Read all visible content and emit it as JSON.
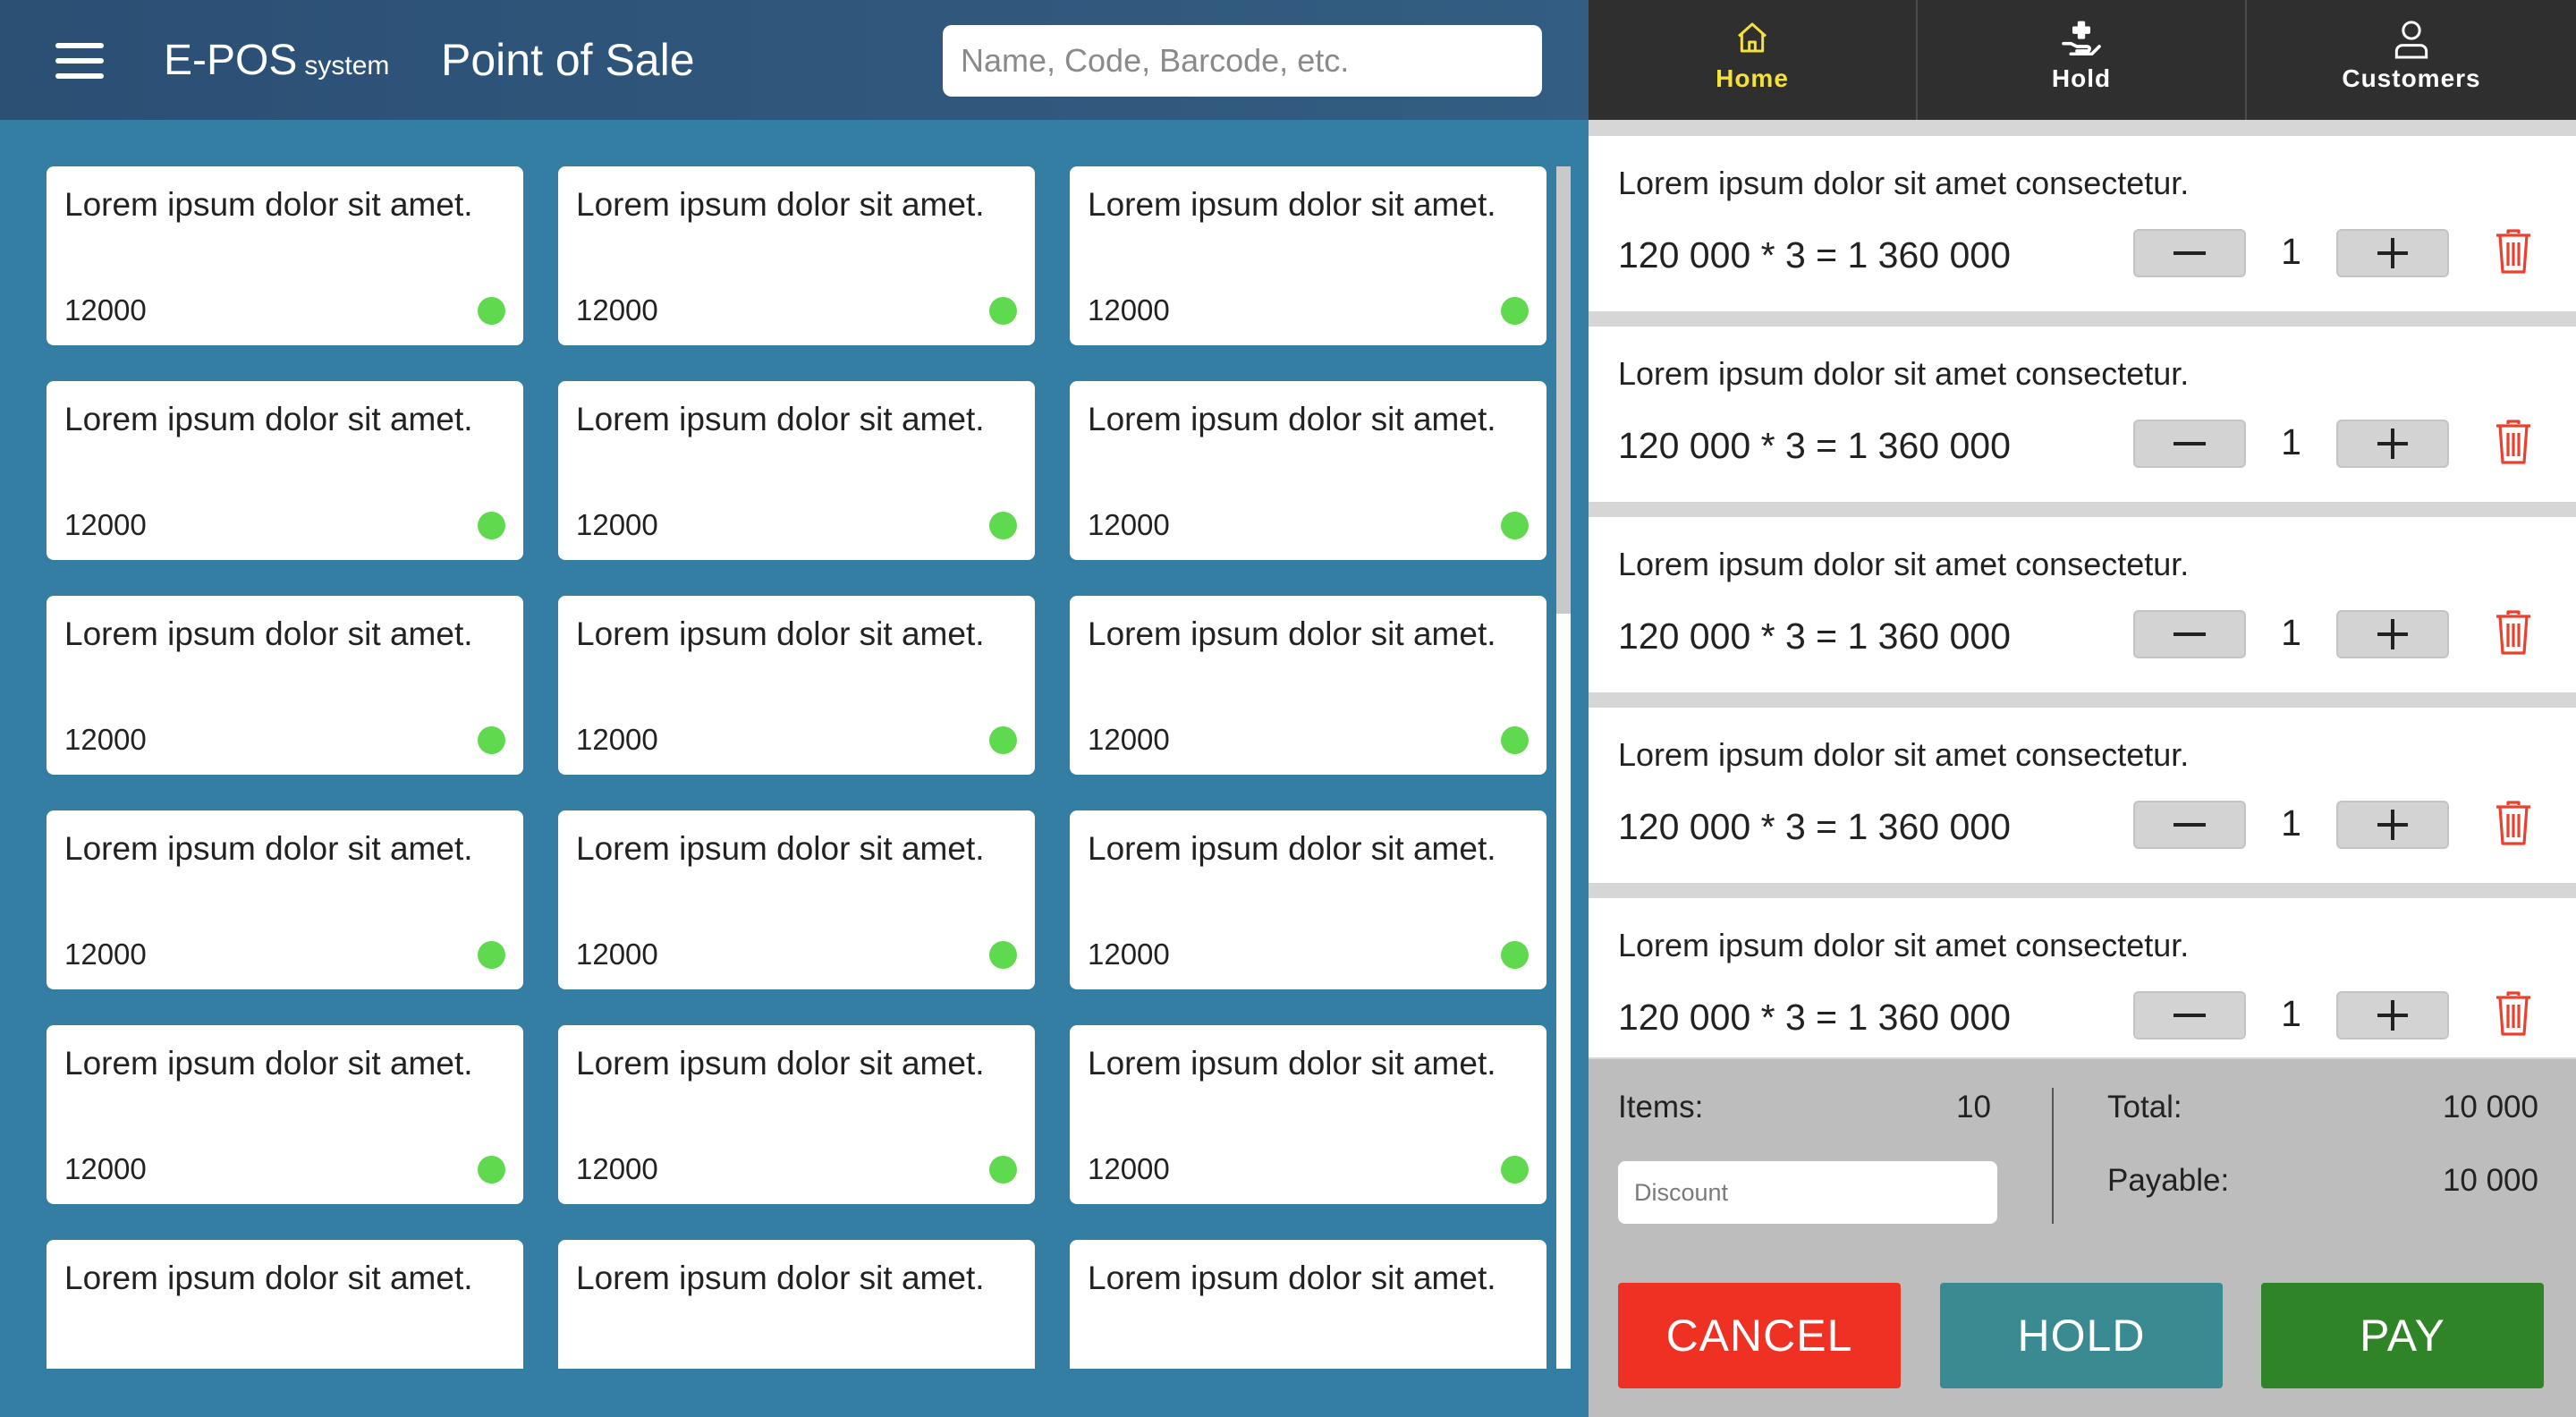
{
  "header": {
    "brand_main": "E-POS",
    "brand_sub": "system",
    "page_title": "Point of Sale",
    "search_placeholder": "Name, Code, Barcode, etc."
  },
  "products": [
    {
      "name": "Lorem ipsum dolor sit amet.",
      "price": "12000",
      "in_stock": true
    },
    {
      "name": "Lorem ipsum dolor sit amet.",
      "price": "12000",
      "in_stock": true
    },
    {
      "name": "Lorem ipsum dolor sit amet.",
      "price": "12000",
      "in_stock": true
    },
    {
      "name": "Lorem ipsum dolor sit amet.",
      "price": "12000",
      "in_stock": true
    },
    {
      "name": "Lorem ipsum dolor sit amet.",
      "price": "12000",
      "in_stock": true
    },
    {
      "name": "Lorem ipsum dolor sit amet.",
      "price": "12000",
      "in_stock": true
    },
    {
      "name": "Lorem ipsum dolor sit amet.",
      "price": "12000",
      "in_stock": true
    },
    {
      "name": "Lorem ipsum dolor sit amet.",
      "price": "12000",
      "in_stock": true
    },
    {
      "name": "Lorem ipsum dolor sit amet.",
      "price": "12000",
      "in_stock": true
    },
    {
      "name": "Lorem ipsum dolor sit amet.",
      "price": "12000",
      "in_stock": true
    },
    {
      "name": "Lorem ipsum dolor sit amet.",
      "price": "12000",
      "in_stock": true
    },
    {
      "name": "Lorem ipsum dolor sit amet.",
      "price": "12000",
      "in_stock": true
    },
    {
      "name": "Lorem ipsum dolor sit amet.",
      "price": "12000",
      "in_stock": true
    },
    {
      "name": "Lorem ipsum dolor sit amet.",
      "price": "12000",
      "in_stock": true
    },
    {
      "name": "Lorem ipsum dolor sit amet.",
      "price": "12000",
      "in_stock": true
    },
    {
      "name": "Lorem ipsum dolor sit amet.",
      "price": "",
      "in_stock": false
    },
    {
      "name": "Lorem ipsum dolor sit amet.",
      "price": "",
      "in_stock": false
    },
    {
      "name": "Lorem ipsum dolor sit amet.",
      "price": "",
      "in_stock": false
    }
  ],
  "nav": {
    "tabs": [
      {
        "label": "Home",
        "icon": "home-icon",
        "active": true
      },
      {
        "label": "Hold",
        "icon": "hand-plus-icon",
        "active": false
      },
      {
        "label": "Customers",
        "icon": "user-icon",
        "active": false
      }
    ]
  },
  "cart": {
    "items": [
      {
        "name": "Lorem ipsum dolor sit amet consectetur.",
        "calc": "120 000 * 3 = 1 360 000",
        "qty": "1"
      },
      {
        "name": "Lorem ipsum dolor sit amet consectetur.",
        "calc": "120 000 * 3 = 1 360 000",
        "qty": "1"
      },
      {
        "name": "Lorem ipsum dolor sit amet consectetur.",
        "calc": "120 000 * 3 = 1 360 000",
        "qty": "1"
      },
      {
        "name": "Lorem ipsum dolor sit amet consectetur.",
        "calc": "120 000 * 3 = 1 360 000",
        "qty": "1"
      },
      {
        "name": "Lorem ipsum dolor sit amet consectetur.",
        "calc": "120 000 * 3 = 1 360 000",
        "qty": "1"
      }
    ]
  },
  "summary": {
    "items_label": "Items:",
    "items_value": "10",
    "total_label": "Total:",
    "total_value": "10 000",
    "payable_label": "Payable:",
    "payable_value": "10 000",
    "discount_placeholder": "Discount"
  },
  "actions": {
    "cancel": "CANCEL",
    "hold": "HOLD",
    "pay": "PAY"
  },
  "colors": {
    "stock_dot": "#5fd94d",
    "active_tab": "#f5e13a",
    "cancel": "#ef3124",
    "hold": "#3a8a92",
    "pay": "#2e8427",
    "trash": "#e8412f"
  }
}
